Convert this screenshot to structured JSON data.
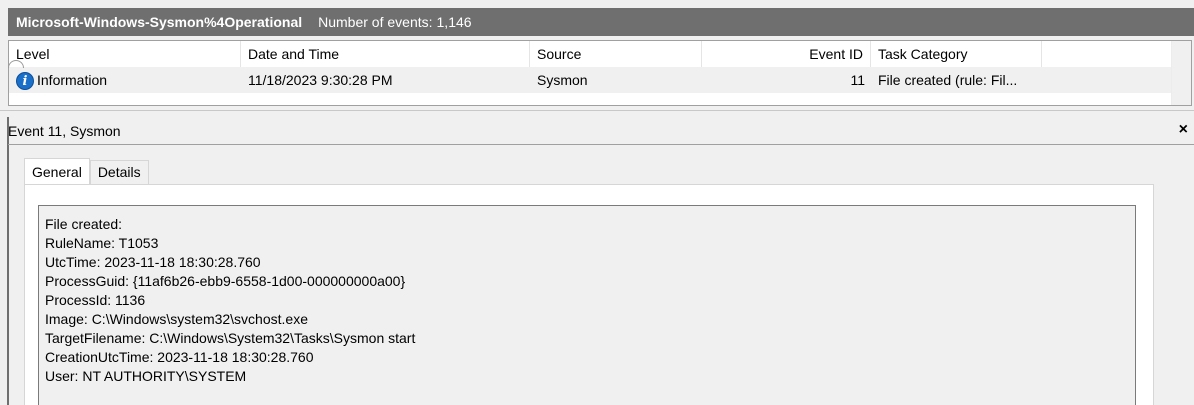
{
  "titlebar": {
    "log_name": "Microsoft-Windows-Sysmon%4Operational",
    "count_label": "Number of events:",
    "count_value": "1,146"
  },
  "grid": {
    "columns": [
      "Level",
      "Date and Time",
      "Source",
      "Event ID",
      "Task Category"
    ],
    "rows": [
      {
        "level": "Information",
        "level_icon": "info-icon",
        "date_time": "11/18/2023 9:30:28 PM",
        "source": "Sysmon",
        "event_id": "11",
        "task_category": "File created (rule: Fil..."
      }
    ]
  },
  "detail": {
    "title": "Event 11, Sysmon",
    "close_label": "×",
    "tabs": [
      "General",
      "Details"
    ],
    "active_tab": "General",
    "lines": [
      "File created:",
      "RuleName: T1053",
      "UtcTime: 2023-11-18 18:30:28.760",
      "ProcessGuid: {11af6b26-ebb9-6558-1d00-000000000a00}",
      "ProcessId: 1136",
      "Image: C:\\Windows\\system32\\svchost.exe",
      "TargetFilename: C:\\Windows\\System32\\Tasks\\Sysmon start",
      "CreationUtcTime: 2023-11-18 18:30:28.760",
      "User: NT AUTHORITY\\SYSTEM"
    ]
  },
  "colors": {
    "titlebar_bg": "#6f6f6f",
    "info_icon": "#1a6fc9",
    "selected_row_bg": "#f0f0f0"
  }
}
